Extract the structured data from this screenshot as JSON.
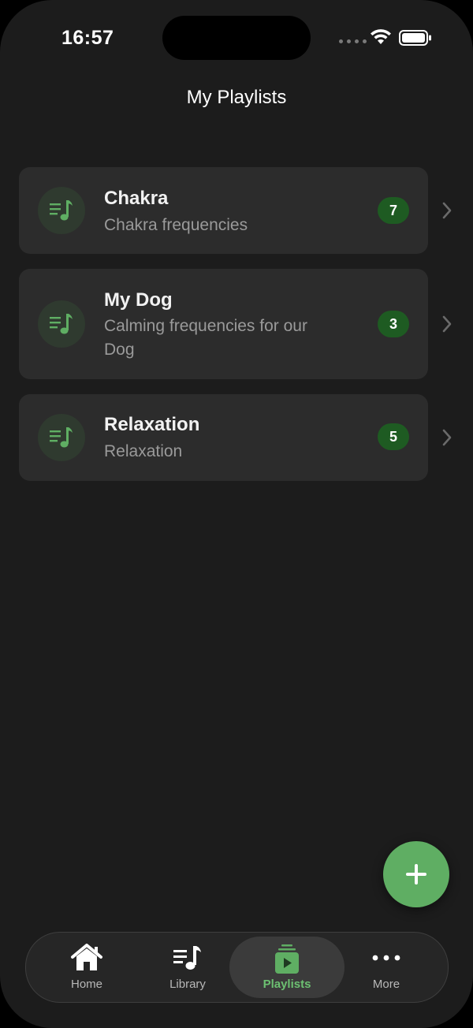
{
  "status_bar": {
    "time": "16:57"
  },
  "header": {
    "title": "My Playlists"
  },
  "playlists": [
    {
      "title": "Chakra",
      "subtitle": "Chakra frequencies",
      "count": "7"
    },
    {
      "title": "My Dog",
      "subtitle": "Calming frequencies for our Dog",
      "count": "3"
    },
    {
      "title": "Relaxation",
      "subtitle": "Relaxation",
      "count": "5"
    }
  ],
  "fab": {
    "icon": "plus-icon"
  },
  "tabs": [
    {
      "label": "Home",
      "icon": "home-icon"
    },
    {
      "label": "Library",
      "icon": "music-list-icon"
    },
    {
      "label": "Playlists",
      "icon": "playlist-play-icon",
      "active": true
    },
    {
      "label": "More",
      "icon": "more-dots-icon"
    }
  ],
  "colors": {
    "background": "#1c1c1c",
    "card": "#2c2c2c",
    "accent": "#5fae63",
    "badge": "#1e5b22",
    "active_tab_label": "#6cc071"
  }
}
